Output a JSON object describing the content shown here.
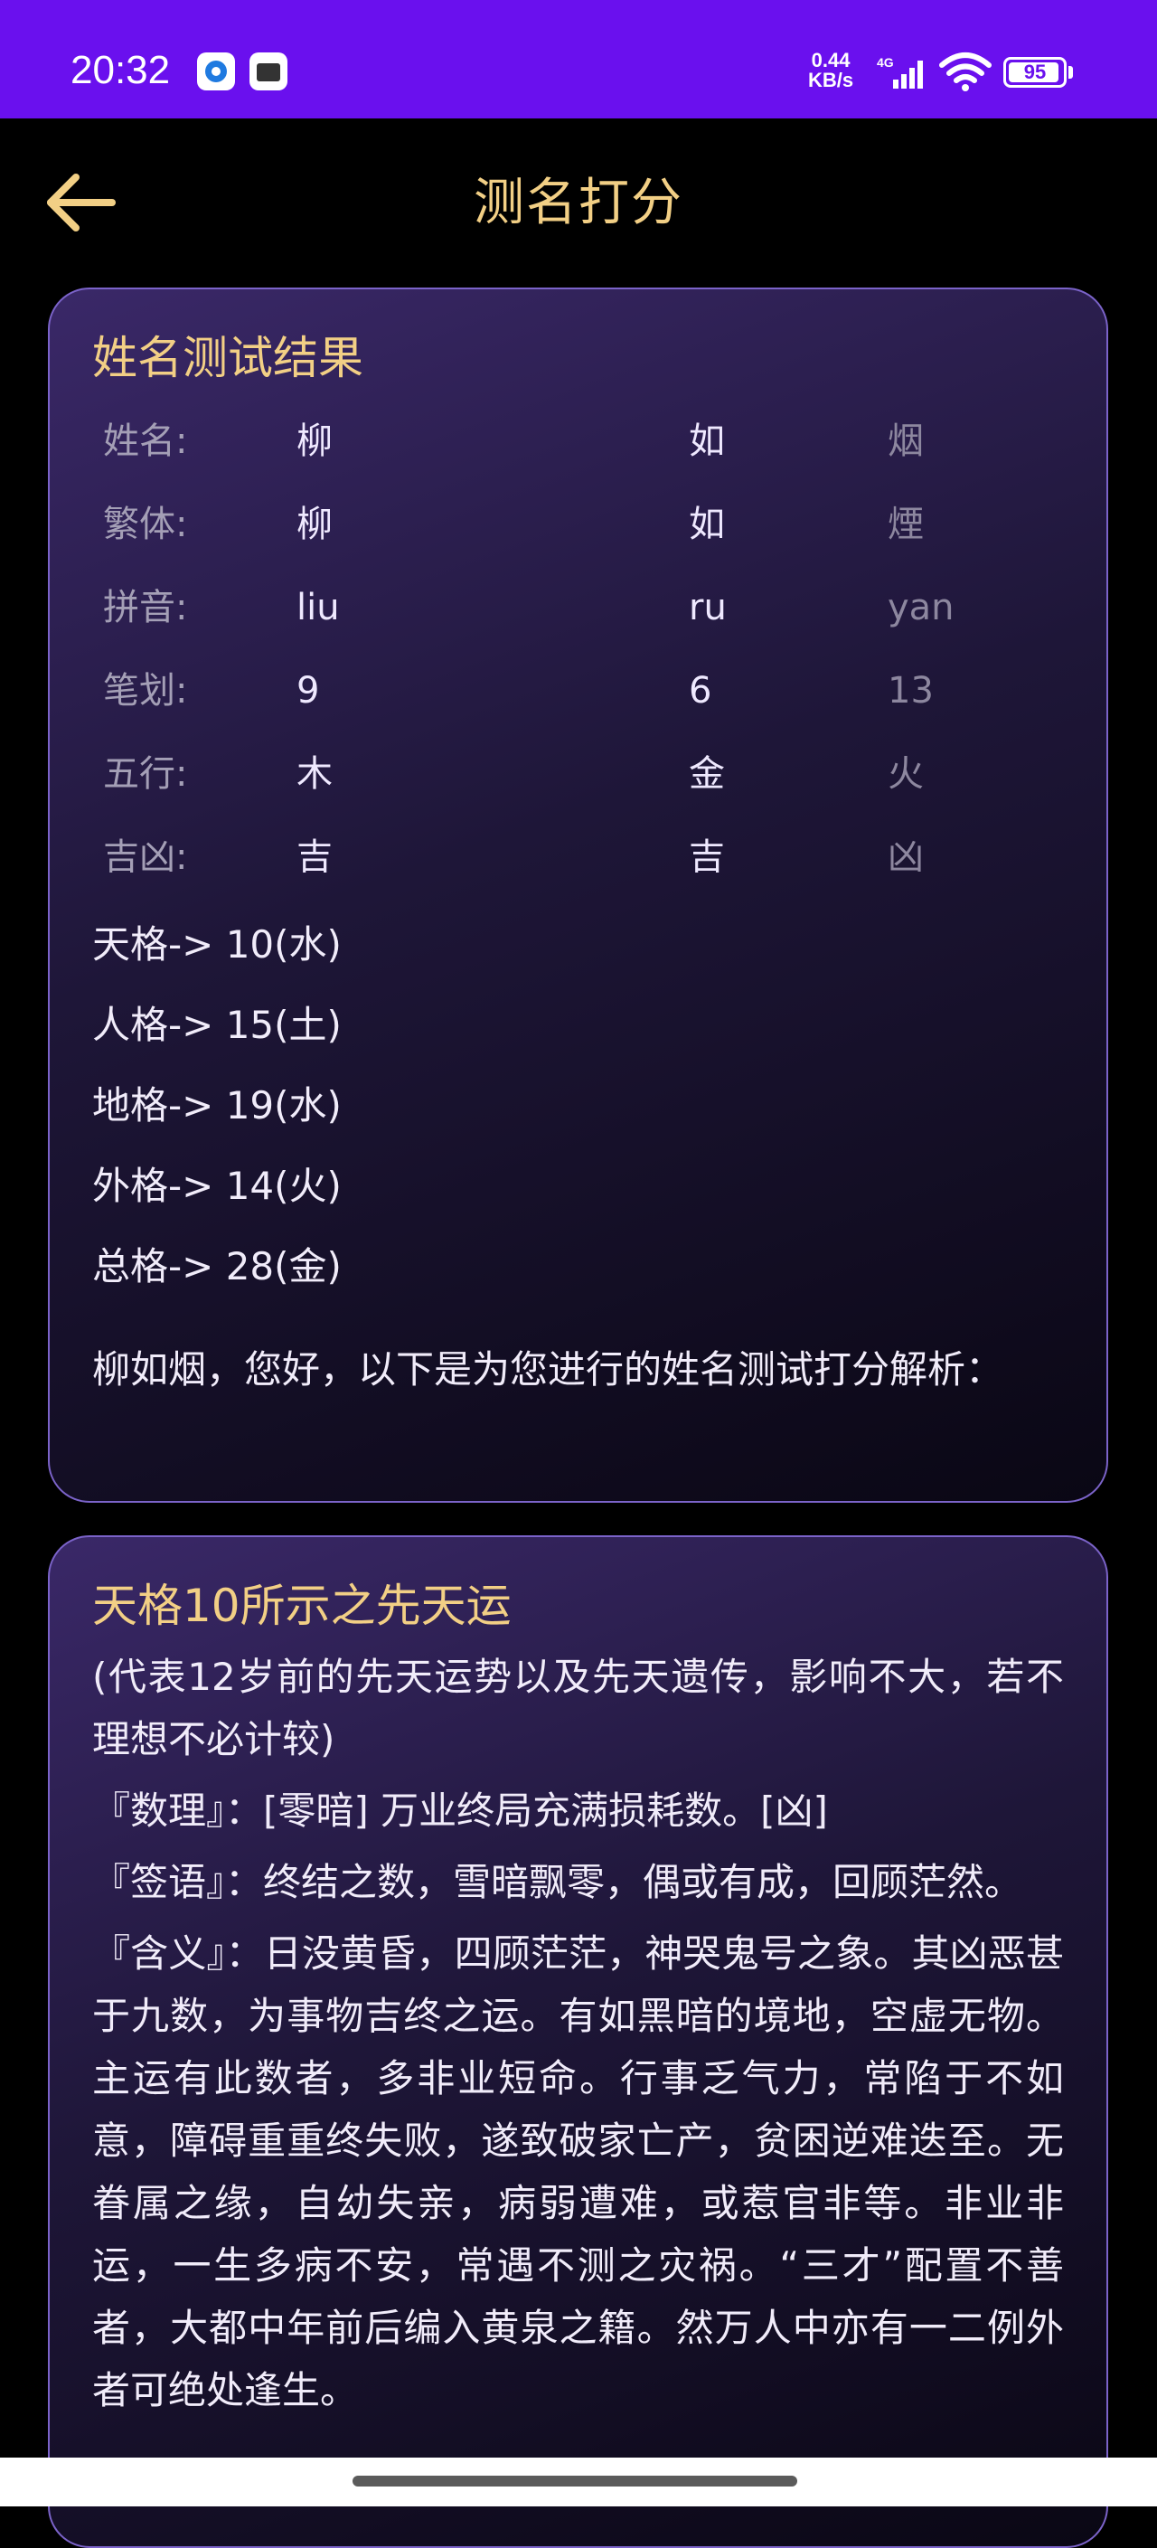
{
  "status_bar": {
    "time": "20:32",
    "net_speed_value": "0.44",
    "net_speed_unit": "KB/s",
    "network_type": "4G",
    "battery": "95",
    "battery_level": 0.95
  },
  "header": {
    "title": "测名打分"
  },
  "result_card": {
    "title": "姓名测试结果",
    "rows": [
      {
        "label": "姓名:",
        "c1": "柳",
        "c2": "如",
        "c3": "烟"
      },
      {
        "label": "繁体:",
        "c1": "柳",
        "c2": "如",
        "c3": "煙"
      },
      {
        "label": "拼音:",
        "c1": "liu",
        "c2": "ru",
        "c3": "yan"
      },
      {
        "label": "笔划:",
        "c1": "9",
        "c2": "6",
        "c3": "13"
      },
      {
        "label": "五行:",
        "c1": "木",
        "c2": "金",
        "c3": "火"
      },
      {
        "label": "吉凶:",
        "c1": "吉",
        "c2": "吉",
        "c3": "凶"
      }
    ],
    "ge": [
      "天格-> 10(水)",
      "人格-> 15(土)",
      "地格-> 19(水)",
      "外格-> 14(火)",
      "总格-> 28(金)"
    ],
    "greeting": "柳如烟，您好，以下是为您进行的姓名测试打分解析："
  },
  "tiange_card": {
    "title": "天格10所示之先天运",
    "note": "(代表12岁前的先天运势以及先天遗传，影响不大，若不理想不必计较)",
    "shuli": "『数理』：[零暗] 万业终局充满损耗数。[凶]",
    "qianyu": "『签语』：终结之数，雪暗飘零，偶或有成，回顾茫然。",
    "hanyi": "『含义』：日没黄昏，四顾茫茫，神哭鬼号之象。其凶恶甚于九数，为事物吉终之运。有如黑暗的境地，空虚无物。主运有此数者，多非业短命。行事乏气力，常陷于不如意，障碍重重终失败，遂致破家亡产，贫困逆难迭至。无眷属之缘，自幼失亲，病弱遭难，或惹官非等。非业非运，一生多病不安，常遇不测之灾祸。“三才”配置不善者，大都中年前后编入黄泉之籍。然万人中亦有一二例外者可绝处逢生。"
  },
  "colors": {
    "status_bar": "#6a10ee",
    "accent_gold": "#f2cf85",
    "card_border": "#7b63c9",
    "background": "#000000"
  }
}
